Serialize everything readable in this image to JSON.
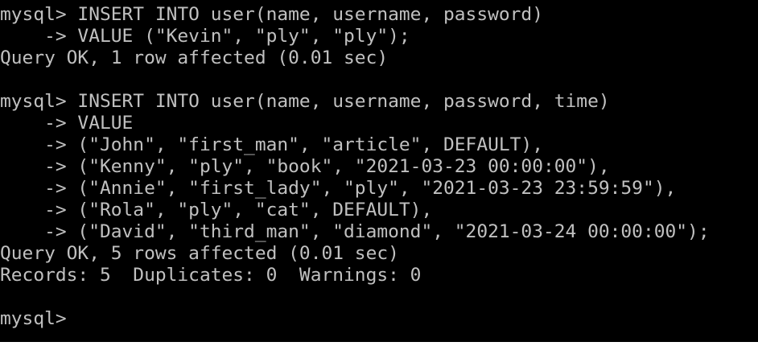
{
  "terminal": {
    "block1": {
      "line1": "mysql> INSERT INTO user(name, username, password)",
      "line2": "    -> VALUE (\"Kevin\", \"ply\", \"ply\");",
      "line3": "Query OK, 1 row affected (0.01 sec)"
    },
    "block2": {
      "line1": "mysql> INSERT INTO user(name, username, password, time)",
      "line2": "    -> VALUE",
      "line3": "    -> (\"John\", \"first_man\", \"article\", DEFAULT),",
      "line4": "    -> (\"Kenny\", \"ply\", \"book\", \"2021-03-23 00:00:00\"),",
      "line5": "    -> (\"Annie\", \"first_lady\", \"ply\", \"2021-03-23 23:59:59\"),",
      "line6": "    -> (\"Rola\", \"ply\", \"cat\", DEFAULT),",
      "line7": "    -> (\"David\", \"third_man\", \"diamond\", \"2021-03-24 00:00:00\");",
      "line8": "Query OK, 5 rows affected (0.01 sec)",
      "line9": "Records: 5  Duplicates: 0  Warnings: 0"
    },
    "prompt": "mysql>"
  },
  "colors": {
    "background": "#000000",
    "text": "#c0c0c0"
  }
}
